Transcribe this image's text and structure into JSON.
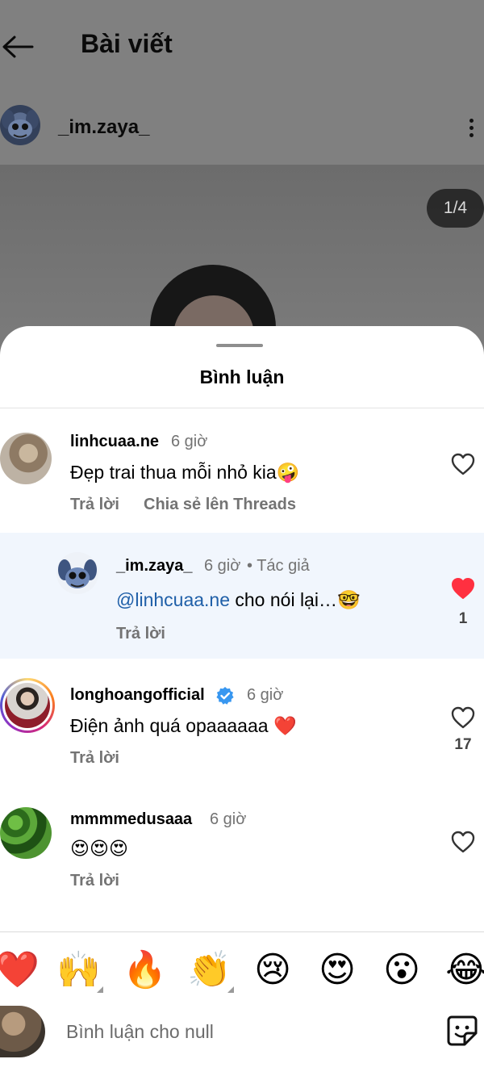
{
  "header": {
    "title": "Bài viết",
    "back_icon": "arrow-left-icon"
  },
  "post": {
    "owner": "_im.zaya_",
    "more_icon": "more-vertical-icon",
    "page_counter": "1/4"
  },
  "sheet": {
    "title": "Bình luận"
  },
  "comments": [
    {
      "user": "linhcuaa.ne",
      "time": "6 giờ",
      "text": "Đẹp trai thua mỗi nhỏ kia",
      "emoji": "🤪",
      "actions": [
        "Trả lời",
        "Chia sẻ lên Threads"
      ],
      "liked": false
    },
    {
      "user": "_im.zaya_",
      "time": "6 giờ",
      "author_tag": "• Tác giả",
      "mention": "@linhcuaa.ne",
      "text": " cho nói lại…",
      "emoji": "🤓",
      "actions": [
        "Trả lời"
      ],
      "liked": true,
      "likes": "1"
    },
    {
      "user": "longhoangofficial",
      "verified": true,
      "time": "6 giờ",
      "text": "Điện ảnh quá opaaaaaa ",
      "emoji": "❤️",
      "actions": [
        "Trả lời"
      ],
      "liked": false,
      "likes": "17"
    },
    {
      "user": "mmmmedusaaa",
      "time": "6 giờ",
      "text": "",
      "emoji": "😍😍😍",
      "actions": [
        "Trả lời"
      ],
      "liked": false
    }
  ],
  "quick_reactions": [
    "❤️",
    "🙌",
    "🔥",
    "👏",
    "😢",
    "😍",
    "😮",
    "😂"
  ],
  "composer": {
    "placeholder": "Bình luận cho null",
    "sticker_icon": "sticker-icon"
  },
  "colors": {
    "like_red": "#ff3040",
    "mention_blue": "#1f5fa8",
    "verified_blue": "#3897f0",
    "reply_bg": "#f1f6fd"
  }
}
